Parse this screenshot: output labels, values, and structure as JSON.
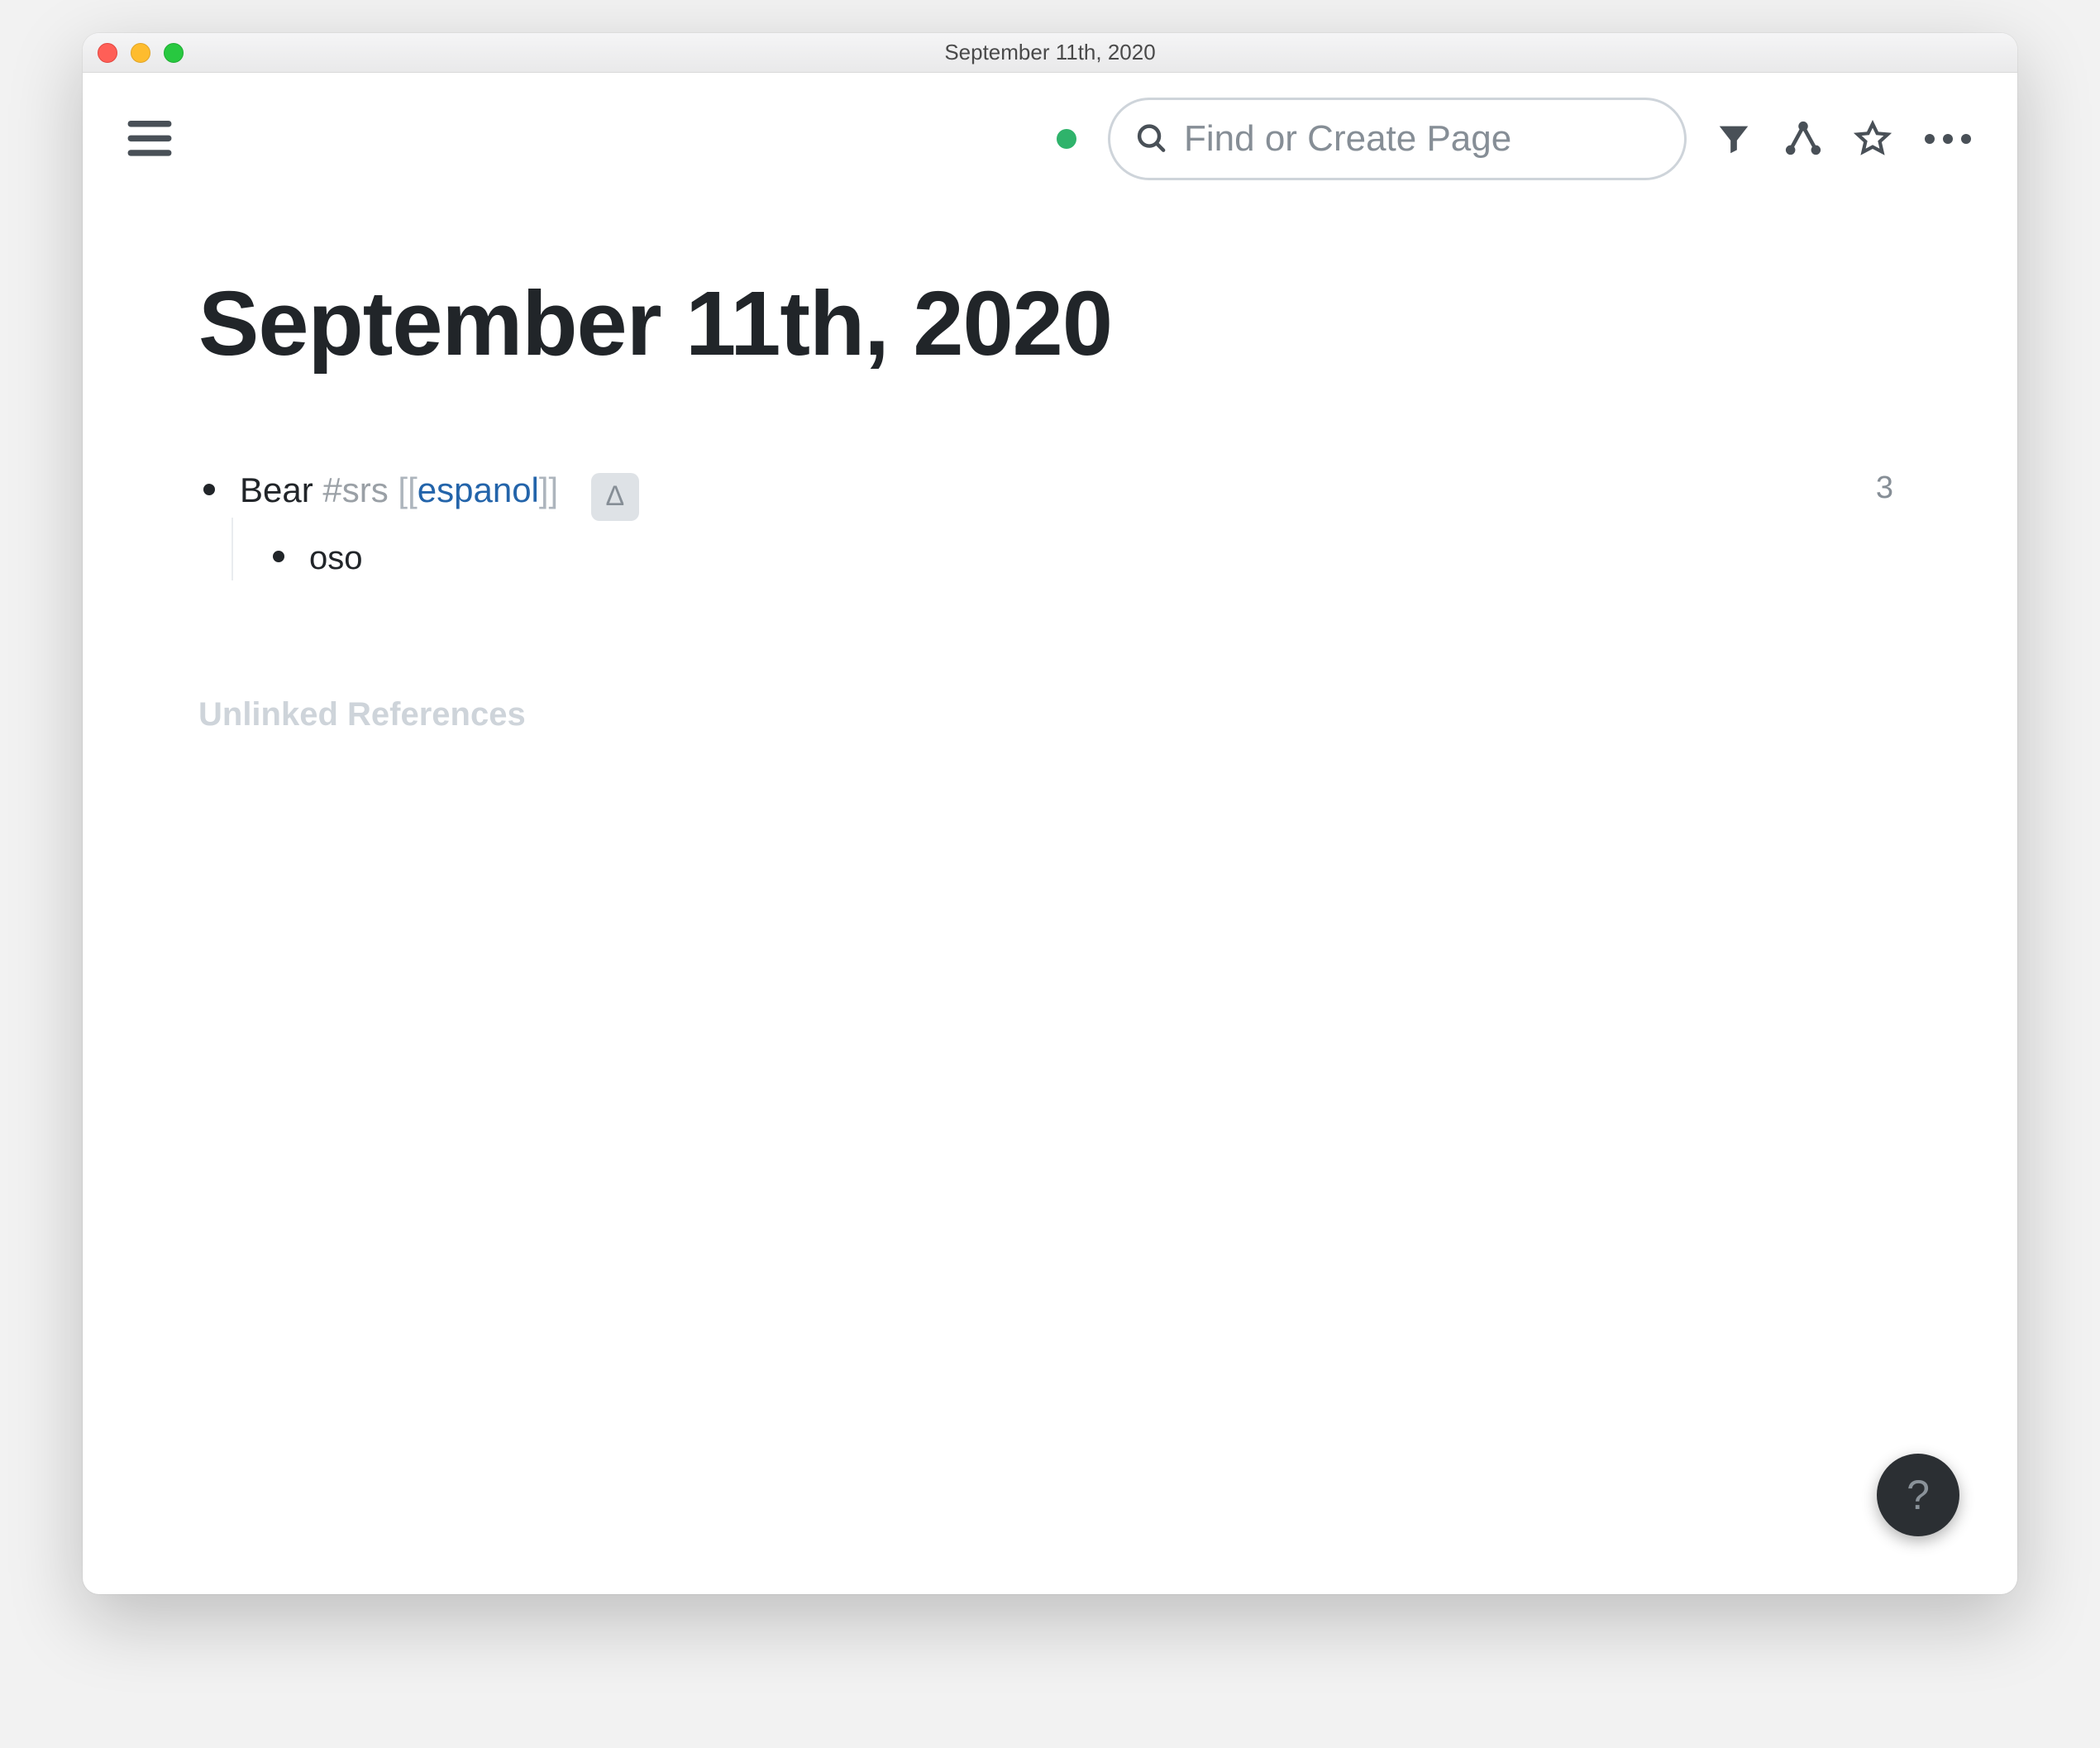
{
  "window": {
    "title": "September 11th, 2020"
  },
  "toolbar": {
    "status": "online",
    "search_placeholder": "Find or Create Page"
  },
  "page": {
    "title": "September 11th, 2020",
    "unlinked_heading": "Unlinked References"
  },
  "blocks": {
    "root": {
      "text_prefix": "Bear ",
      "tag": "#srs",
      "link_name": "espanol",
      "bracket_open": "[[",
      "bracket_close": "]]",
      "delta_label": "Δ",
      "reference_count": "3"
    },
    "child": {
      "text": "oso"
    }
  },
  "help": {
    "label": "?"
  }
}
